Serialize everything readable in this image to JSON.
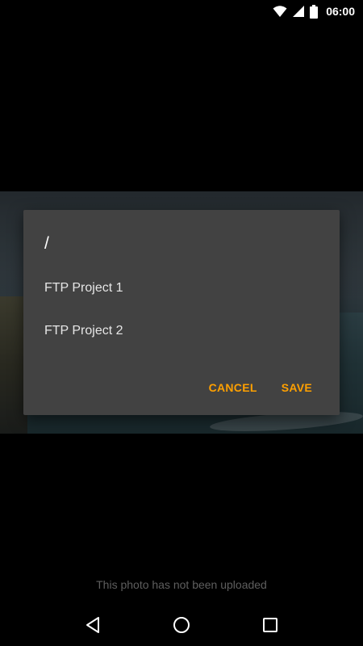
{
  "status_bar": {
    "time": "06:00",
    "icons": [
      "wifi-icon",
      "cell-signal-icon",
      "battery-icon"
    ]
  },
  "dialog": {
    "path": "/",
    "folders": [
      {
        "label": "FTP Project 1"
      },
      {
        "label": "FTP Project 2"
      }
    ],
    "cancel_label": "CANCEL",
    "save_label": "SAVE",
    "accent_color": "#ffa000",
    "background_color": "#424242"
  },
  "upload_status": "This photo has not been uploaded",
  "nav_bar": {
    "icons": [
      "back-icon",
      "home-icon",
      "recents-icon"
    ]
  }
}
